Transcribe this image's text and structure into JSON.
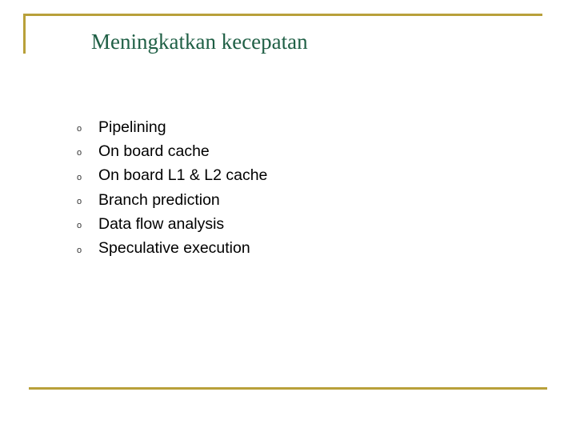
{
  "slide": {
    "title": "Meningkatkan kecepatan",
    "bullet_marker": "o",
    "bullets": [
      "Pipelining",
      "On board cache",
      "On board L1 & L2 cache",
      "Branch prediction",
      "Data flow analysis",
      "Speculative execution"
    ],
    "accent_color": "#b8a03a",
    "title_color": "#1f5f45"
  }
}
